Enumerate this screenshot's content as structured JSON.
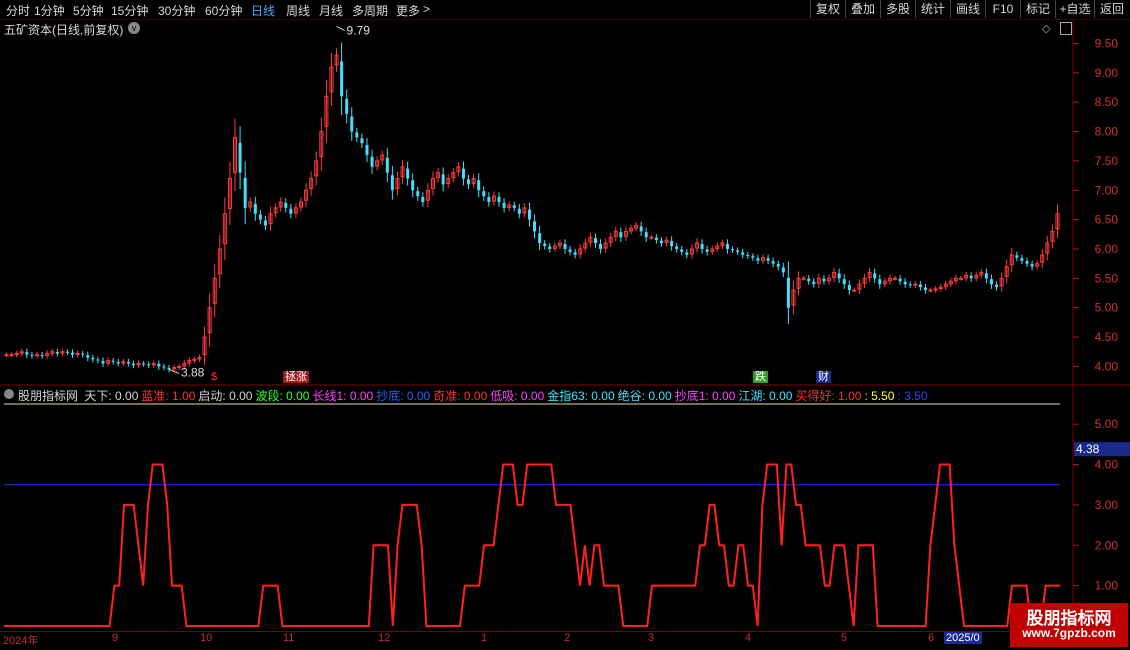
{
  "toolbar": {
    "periods": [
      "分时",
      "1分钟",
      "5分钟",
      "15分钟",
      "30分钟",
      "60分钟",
      "日线",
      "周线",
      "月线",
      "多周期",
      "更多"
    ],
    "more_arrow": ">",
    "active_period": "日线",
    "right_buttons": [
      "复权",
      "叠加",
      "多股",
      "统计",
      "画线",
      "F10",
      "标记",
      "+自选",
      "返回"
    ]
  },
  "main_chart": {
    "title": "五矿资本(日线,前复权)",
    "title_chevron": "v",
    "high_label": "9.79",
    "low_label": "3.88",
    "price_axis": [
      "9.50",
      "9.00",
      "8.50",
      "8.00",
      "7.50",
      "7.00",
      "6.50",
      "6.00",
      "5.50",
      "5.00",
      "4.50",
      "4.00"
    ],
    "signals": [
      {
        "text": "$",
        "color": "#ff3030",
        "bg": "transparent"
      },
      {
        "text": "拯涨",
        "color": "#ffffff",
        "bg": "#a01818"
      },
      {
        "text": "跌",
        "color": "#ffffff",
        "bg": "#2aa02a"
      },
      {
        "text": "财",
        "color": "#ffffff",
        "bg": "#1a2a8a"
      }
    ]
  },
  "indicator": {
    "name": "股朋指标网",
    "items": [
      {
        "label": "天下:",
        "value": "0.00",
        "color": "#d0d0d0"
      },
      {
        "label": "蓝准:",
        "value": "1.00",
        "color": "#ff3030"
      },
      {
        "label": "启动:",
        "value": "0.00",
        "color": "#d0d0d0"
      },
      {
        "label": "波段:",
        "value": "0.00",
        "color": "#30ff30"
      },
      {
        "label": "长线1:",
        "value": "0.00",
        "color": "#ff40ff"
      },
      {
        "label": "抄底:",
        "value": "0.00",
        "color": "#2060ff"
      },
      {
        "label": "奇准:",
        "value": "0.00",
        "color": "#ff3030"
      },
      {
        "label": "低吸:",
        "value": "0.00",
        "color": "#ff40ff"
      },
      {
        "label": "金指63:",
        "value": "0.00",
        "color": "#40e0ff"
      },
      {
        "label": "绝谷:",
        "value": "0.00",
        "color": "#40e0ff"
      },
      {
        "label": "抄底1:",
        "value": "0.00",
        "color": "#ff40ff"
      },
      {
        "label": "江湖:",
        "value": "0.00",
        "color": "#40e0ff"
      },
      {
        "label": "买得好:",
        "value": "1.00",
        "color": "#ff3030"
      },
      {
        "label": ":",
        "value": "5.50",
        "color": "#ffff40"
      },
      {
        "label": ":",
        "value": "3.50",
        "color": "#3040ff"
      }
    ],
    "axis": [
      "5.00",
      "4.00",
      "3.00",
      "2.00",
      "1.00"
    ],
    "current_value": "4.38",
    "series": [
      0,
      0,
      0,
      0,
      0,
      0,
      0,
      0,
      0,
      0,
      0,
      0,
      0,
      0,
      0,
      0,
      0,
      0,
      0,
      0,
      0,
      0,
      0,
      1,
      1,
      3,
      3,
      3,
      2,
      1,
      3,
      4,
      4,
      4,
      3,
      1,
      1,
      1,
      0,
      0,
      0,
      0,
      0,
      0,
      0,
      0,
      0,
      0,
      0,
      0,
      0,
      0,
      0,
      0,
      1,
      1,
      1,
      1,
      0,
      0,
      0,
      0,
      0,
      0,
      0,
      0,
      0,
      0,
      0,
      0,
      0,
      0,
      0,
      0,
      0,
      0,
      0,
      2,
      2,
      2,
      2,
      0,
      2,
      3,
      3,
      3,
      3,
      2,
      0,
      0,
      0,
      0,
      0,
      0,
      0,
      0,
      1,
      1,
      1,
      1,
      2,
      2,
      2,
      3,
      4,
      4,
      4,
      3,
      3,
      4,
      4,
      4,
      4,
      4,
      4,
      3,
      3,
      3,
      3,
      2,
      1,
      2,
      1,
      2,
      2,
      1,
      1,
      1,
      1,
      0,
      0,
      0,
      0,
      0,
      0,
      1,
      1,
      1,
      1,
      1,
      1,
      1,
      1,
      1,
      1,
      2,
      2,
      3,
      3,
      2,
      2,
      1,
      1,
      2,
      2,
      1,
      1,
      0,
      3,
      4,
      4,
      4,
      2,
      4,
      4,
      3,
      3,
      2,
      2,
      2,
      2,
      1,
      1,
      2,
      2,
      2,
      1,
      0,
      2,
      2,
      2,
      2,
      0,
      0,
      0,
      0,
      0,
      0,
      0,
      0,
      0,
      0,
      0,
      2,
      3,
      4,
      4,
      4,
      2,
      1,
      0,
      0,
      0,
      0,
      0,
      0,
      0,
      0,
      0,
      0,
      1,
      1,
      1,
      1,
      0,
      0,
      0,
      1,
      1,
      1,
      1
    ]
  },
  "chart_data": [
    {
      "type": "line",
      "chart_kind": "candlestick-close",
      "title": "五矿资本(日线,前复权)",
      "ylim": [
        3.7,
        9.9
      ],
      "high": 9.79,
      "low": 3.88,
      "closes": [
        4.2,
        4.2,
        4.22,
        4.25,
        4.2,
        4.18,
        4.2,
        4.18,
        4.22,
        4.25,
        4.22,
        4.25,
        4.24,
        4.2,
        4.22,
        4.2,
        4.15,
        4.12,
        4.1,
        4.05,
        4.1,
        4.08,
        4.05,
        4.08,
        4.05,
        4.02,
        4.05,
        4.04,
        4.02,
        4.05,
        4.0,
        3.98,
        3.95,
        3.98,
        4.0,
        4.05,
        4.1,
        4.12,
        4.15,
        4.5,
        5.0,
        5.5,
        6.0,
        6.6,
        7.2,
        7.9,
        7.3,
        6.7,
        6.8,
        6.6,
        6.5,
        6.4,
        6.6,
        6.7,
        6.8,
        6.7,
        6.6,
        6.7,
        6.8,
        7.0,
        7.2,
        7.5,
        8.0,
        8.6,
        9.1,
        9.3,
        8.6,
        8.3,
        8.0,
        7.9,
        7.8,
        7.6,
        7.4,
        7.5,
        7.6,
        7.3,
        7.0,
        7.2,
        7.4,
        7.2,
        7.0,
        6.9,
        6.8,
        7.0,
        7.2,
        7.3,
        7.1,
        7.2,
        7.3,
        7.4,
        7.2,
        7.1,
        7.2,
        7.0,
        6.9,
        6.8,
        6.9,
        6.8,
        6.7,
        6.75,
        6.7,
        6.6,
        6.7,
        6.5,
        6.3,
        6.1,
        6.05,
        6.0,
        6.05,
        6.1,
        6.0,
        5.95,
        5.9,
        6.0,
        6.1,
        6.2,
        6.1,
        6.0,
        6.1,
        6.2,
        6.3,
        6.2,
        6.3,
        6.35,
        6.4,
        6.3,
        6.2,
        6.2,
        6.15,
        6.1,
        6.15,
        6.05,
        6.0,
        5.95,
        5.9,
        6.0,
        6.1,
        6.0,
        5.95,
        6.0,
        6.05,
        6.1,
        6.0,
        5.98,
        5.95,
        5.9,
        5.88,
        5.85,
        5.8,
        5.85,
        5.8,
        5.75,
        5.7,
        5.6,
        5.0,
        5.3,
        5.5,
        5.5,
        5.45,
        5.4,
        5.5,
        5.45,
        5.5,
        5.6,
        5.5,
        5.4,
        5.3,
        5.3,
        5.4,
        5.5,
        5.6,
        5.5,
        5.4,
        5.45,
        5.5,
        5.5,
        5.45,
        5.4,
        5.38,
        5.4,
        5.35,
        5.3,
        5.3,
        5.32,
        5.35,
        5.4,
        5.45,
        5.5,
        5.5,
        5.55,
        5.5,
        5.55,
        5.6,
        5.5,
        5.4,
        5.35,
        5.5,
        5.7,
        5.9,
        5.85,
        5.8,
        5.75,
        5.7,
        5.75,
        5.9,
        6.1,
        6.3,
        6.6
      ]
    },
    {
      "type": "line",
      "title": "股朋指标网",
      "ylim": [
        0,
        5.5
      ],
      "reference_line": 3.5,
      "current": 4.38
    }
  ],
  "time_axis": [
    "2024年",
    "9",
    "10",
    "11",
    "12",
    "1",
    "2",
    "3",
    "4",
    "5",
    "6",
    "2025/0"
  ],
  "logo": {
    "name": "股朋指标网",
    "url": "www.7gpzb.com"
  },
  "colors": {
    "up": "#ff3a3a",
    "down": "#40e0ff",
    "indicator": "#ff2020",
    "ref": "#2030ff",
    "grid": "#800000"
  }
}
